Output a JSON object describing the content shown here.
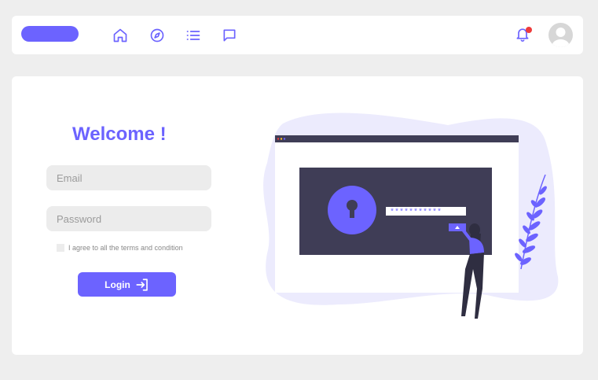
{
  "colors": {
    "accent": "#6c63ff",
    "notification_dot": "#ee3b3b",
    "page_background": "#eeeeee",
    "input_background": "#ececec",
    "illustration_screen": "#3f3d56"
  },
  "header": {
    "logo_icon": "logo-pill",
    "nav_icons": [
      "home-icon",
      "compass-icon",
      "list-icon",
      "chat-icon"
    ],
    "notification_icon": "bell-icon",
    "avatar_icon": "user-avatar"
  },
  "login": {
    "title": "Welcome !",
    "email_placeholder": "Email",
    "password_placeholder": "Password",
    "terms_label": "I agree to all the terms and condition",
    "login_label": "Login",
    "login_icon": "login-arrow-icon"
  },
  "illustration": {
    "password_mask": "***********"
  }
}
